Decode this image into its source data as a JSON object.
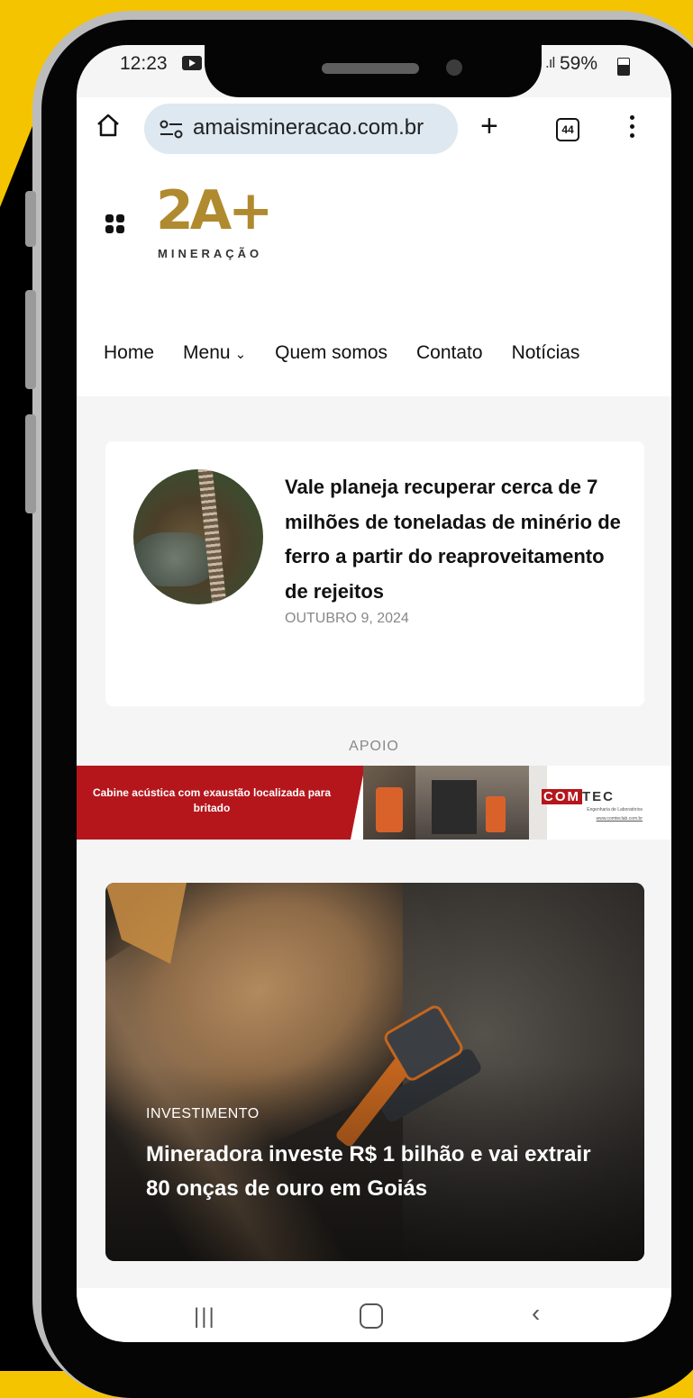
{
  "status": {
    "time": "12:23",
    "battery": "59%"
  },
  "browser": {
    "url": "amaismineracao.com.br",
    "tab_count": "44"
  },
  "site": {
    "logo": {
      "mark": "2A+",
      "subtitle": "MINERAÇÃO"
    },
    "nav": [
      {
        "label": "Home"
      },
      {
        "label": "Menu",
        "chevron": "chevron-down-icon"
      },
      {
        "label": "Quem somos"
      },
      {
        "label": "Contato"
      },
      {
        "label": "Notícias"
      }
    ]
  },
  "featured_card": {
    "title": "Vale planeja recuperar cerca de 7 milhões de toneladas de minério de ferro a partir do reaproveitamento de rejeitos",
    "date": "OUTUBRO 9, 2024"
  },
  "support": {
    "label": "APOIO",
    "banner_text": "Cabine acústica com exaustão localizada para britado",
    "sponsor_brand": "COMTEC",
    "sponsor_tagline": "Engenharia de Laboratórios",
    "sponsor_url": "www.comteclab.com.br"
  },
  "feature_article": {
    "category": "INVESTIMENTO",
    "title": "Mineradora investe R$ 1 bilhão e vai extrair 80 onças de ouro em Goiás"
  },
  "colors": {
    "frame": "#f5c400",
    "brand_gold": "#b08a2e",
    "banner_red": "#b5161c"
  }
}
